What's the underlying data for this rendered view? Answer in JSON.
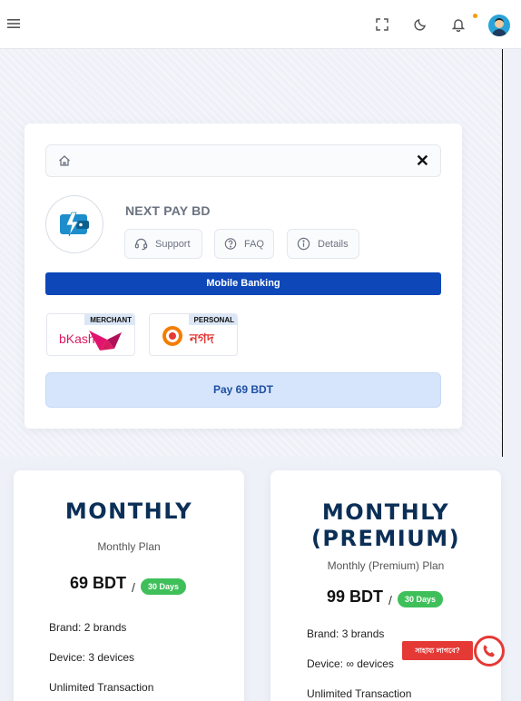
{
  "topbar": {
    "menu_icon": "hamburger-menu-icon",
    "fullscreen_icon": "fullscreen-icon",
    "theme_icon": "moon-icon",
    "notification_icon": "bell-icon",
    "accent": "#f59e0b"
  },
  "checkout": {
    "brand_name": "NEXT PAY BD",
    "actions": [
      {
        "label": "Support",
        "icon": "headset-icon"
      },
      {
        "label": "FAQ",
        "icon": "question-icon"
      },
      {
        "label": "Details",
        "icon": "info-icon"
      }
    ],
    "section_title": "Mobile Banking",
    "methods": [
      {
        "name": "bKash",
        "tag": "MERCHANT"
      },
      {
        "name": "নগদ",
        "tag": "PERSONAL"
      }
    ],
    "pay_label": "Pay 69 BDT",
    "colors": {
      "primary": "#0d47b8",
      "pay_bg": "#d6e5fb"
    }
  },
  "plans": [
    {
      "title_line1": "MONTHLY",
      "title_line2": "",
      "subtitle": "Monthly Plan",
      "price": "69 BDT",
      "period": "30 Days",
      "features": [
        "Brand: 2 brands",
        "Device: 3 devices",
        "Unlimited Transaction"
      ]
    },
    {
      "title_line1": "MONTHLY",
      "title_line2": "(PREMIUM)",
      "subtitle": "Monthly (Premium) Plan",
      "price": "99 BDT",
      "period": "30 Days",
      "features": [
        "Brand: 3 brands",
        "Device: ∞ devices",
        "Unlimited Transaction"
      ]
    }
  ],
  "help": {
    "label": "সাহায্য লাগবে?"
  }
}
